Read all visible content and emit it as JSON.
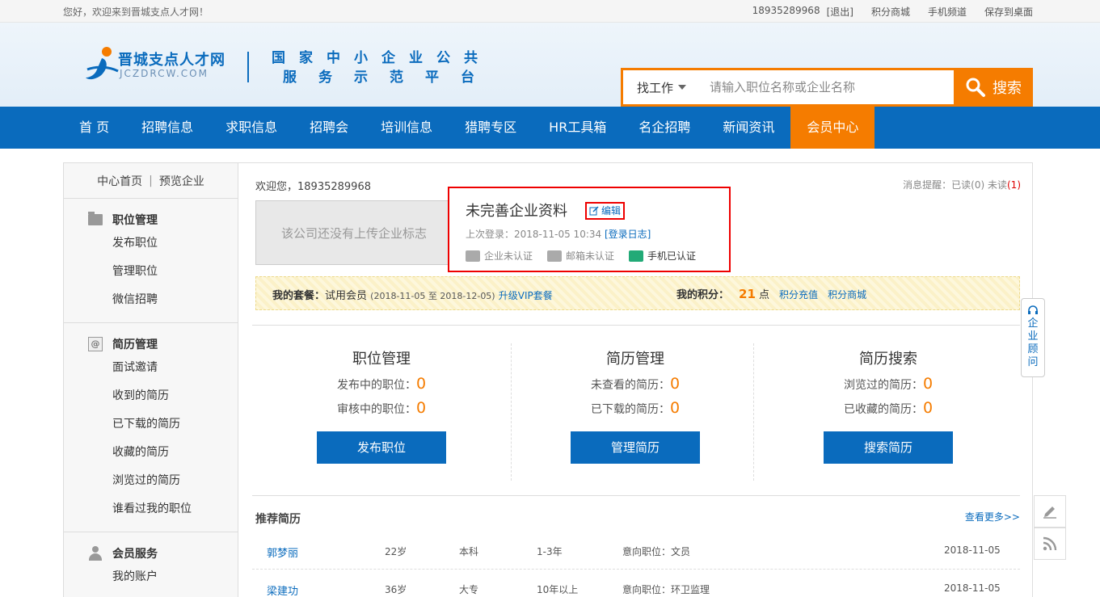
{
  "topbar": {
    "welcome": "您好，欢迎来到晋城支点人才网！",
    "phone": "18935289968",
    "logout": "[退出]",
    "points_mall": "积分商城",
    "mobile": "手机频道",
    "save_desktop": "保存到桌面"
  },
  "header": {
    "logo_name": "晋城支点人才网",
    "logo_domain": "JCZDRCW.COM",
    "slogan_line1": "国家中小企业公共",
    "slogan_line2": "服务示范平台",
    "search_type": "找工作",
    "search_placeholder": "请输入职位名称或企业名称",
    "search_button": "搜索"
  },
  "nav": {
    "items": [
      "首 页",
      "招聘信息",
      "求职信息",
      "招聘会",
      "培训信息",
      "猎聘专区",
      "HR工具箱",
      "名企招聘",
      "新闻资讯",
      "会员中心"
    ]
  },
  "sidebar": {
    "home": "中心首页",
    "preview": "预览企业",
    "sections": [
      {
        "title": "职位管理",
        "items": [
          "发布职位",
          "管理职位",
          "微信招聘"
        ]
      },
      {
        "title": "简历管理",
        "items": [
          "面试邀请",
          "收到的简历",
          "已下载的简历",
          "收藏的简历",
          "浏览过的简历",
          "谁看过我的职位"
        ]
      },
      {
        "title": "会员服务",
        "items": [
          "我的账户"
        ]
      }
    ]
  },
  "content": {
    "welcome": "欢迎您，18935289968",
    "msg_label": "消息提醒：已读",
    "msg_read": "(0)",
    "msg_unread_label": "未读",
    "msg_unread": "(1)",
    "logo_placeholder": "该公司还没有上传企业标志",
    "profile_title": "未完善企业资料",
    "edit": "编辑",
    "last_login": "上次登录：2018-11-05 10:34",
    "login_log": "[登录日志]",
    "cert_company": "企业未认证",
    "cert_email": "邮箱未认证",
    "cert_phone": "手机已认证",
    "package_label": "我的套餐：",
    "package_name": "试用会员",
    "package_period": "(2018-11-05 至 2018-12-05)",
    "upgrade": "升级VIP套餐",
    "points_label": "我的积分：",
    "points_value": "21",
    "points_unit": "点",
    "recharge": "积分充值",
    "points_mall": "积分商城"
  },
  "stats": [
    {
      "title": "职位管理",
      "rows": [
        {
          "label": "发布中的职位：",
          "value": "0"
        },
        {
          "label": "审核中的职位：",
          "value": "0"
        }
      ],
      "button": "发布职位"
    },
    {
      "title": "简历管理",
      "rows": [
        {
          "label": "未查看的简历：",
          "value": "0"
        },
        {
          "label": "已下载的简历：",
          "value": "0"
        }
      ],
      "button": "管理简历"
    },
    {
      "title": "简历搜索",
      "rows": [
        {
          "label": "浏览过的简历：",
          "value": "0"
        },
        {
          "label": "已收藏的简历：",
          "value": "0"
        }
      ],
      "button": "搜索简历"
    }
  ],
  "recommend": {
    "title": "推荐简历",
    "more": "查看更多>>",
    "rows": [
      {
        "name": "郭梦丽",
        "age": "22岁",
        "edu": "本科",
        "exp": "1-3年",
        "pos": "意向职位：文员",
        "date": "2018-11-05"
      },
      {
        "name": "梁建功",
        "age": "36岁",
        "edu": "大专",
        "exp": "10年以上",
        "pos": "意向职位：环卫监理",
        "date": "2018-11-05"
      }
    ]
  },
  "advisor": {
    "text": "企业顾问"
  }
}
